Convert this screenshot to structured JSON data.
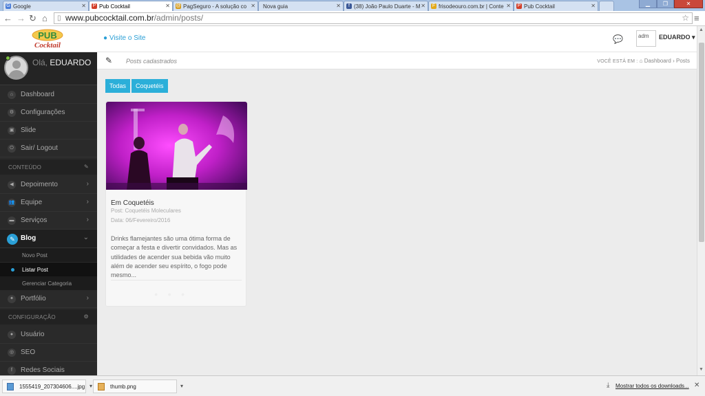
{
  "browser": {
    "tabs": [
      {
        "title": "Google",
        "icon": "google-icon",
        "fav": "G",
        "color": "#4a7dd8"
      },
      {
        "title": "Pub Cocktail",
        "icon": "pub-cocktail-icon",
        "fav": "P",
        "color": "#d33f2a"
      },
      {
        "title": "PagSeguro - A solução co",
        "icon": "pagseguro-icon",
        "fav": "@",
        "color": "#d59b1d"
      },
      {
        "title": "Nova guia",
        "icon": "",
        "fav": "",
        "color": ""
      },
      {
        "title": "(38) João Paulo Duarte - M",
        "icon": "facebook-icon",
        "fav": "f",
        "color": "#3b5998"
      },
      {
        "title": "frisodeouro.com.br | Conte",
        "icon": "friso-icon",
        "fav": "F",
        "color": "#e3a91a"
      },
      {
        "title": "Pub Cocktail",
        "icon": "pub-cocktail-icon",
        "fav": "P",
        "color": "#d33f2a"
      }
    ],
    "url_host": "www.pubcocktail.com.br",
    "url_path": "/admin/posts/"
  },
  "header": {
    "logo_text": "PUB Cocktail",
    "visit_site": "Visite o Site",
    "avatar_alt": "adm",
    "user_name": "EDUARDO"
  },
  "sidebar": {
    "greeting": "Olá,",
    "user_name": "EDUARDO",
    "items_top": [
      "Dashboard",
      "Configurações",
      "Slide",
      "Sair/ Logout"
    ],
    "section_content": "CONTEÚDO",
    "items_content": [
      "Depoimento",
      "Equipe",
      "Serviços"
    ],
    "blog": "Blog",
    "blog_sub": [
      "Novo Post",
      "Listar Post",
      "Gerenciar Categoria"
    ],
    "portfolio": "Portfólio",
    "section_config": "CONFIGURAÇÃO",
    "items_config": [
      "Usuário",
      "SEO",
      "Redes Sociais"
    ]
  },
  "page": {
    "title": "Posts cadastrados",
    "breadcrumb_label": "VOCÊ ESTÁ EM :",
    "breadcrumb_home": "Dashboard",
    "breadcrumb_current": "Posts",
    "filters": [
      "Todas",
      "Coquetéis"
    ]
  },
  "post": {
    "title": "Em Coquetéis",
    "post_line": "Post: Coquetéis Moleculares",
    "date_line": "Data: 06/Fevereiro/2016",
    "excerpt": "Drinks flamejantes são uma ótima forma de começar a festa e divertir convidados. Mas as utilidades de acender sua bebida vão muito além de acender seu espírito,  o fogo pode mesmo..."
  },
  "downloads": {
    "items": [
      "1555419_207304606....jpg",
      "thumb.png"
    ],
    "show_all": "Mostrar todos os downloads..."
  },
  "colors": {
    "accent": "#2a9fd6",
    "filter_button": "#2bafd9",
    "sidebar_bg": "#2a2a2a"
  }
}
